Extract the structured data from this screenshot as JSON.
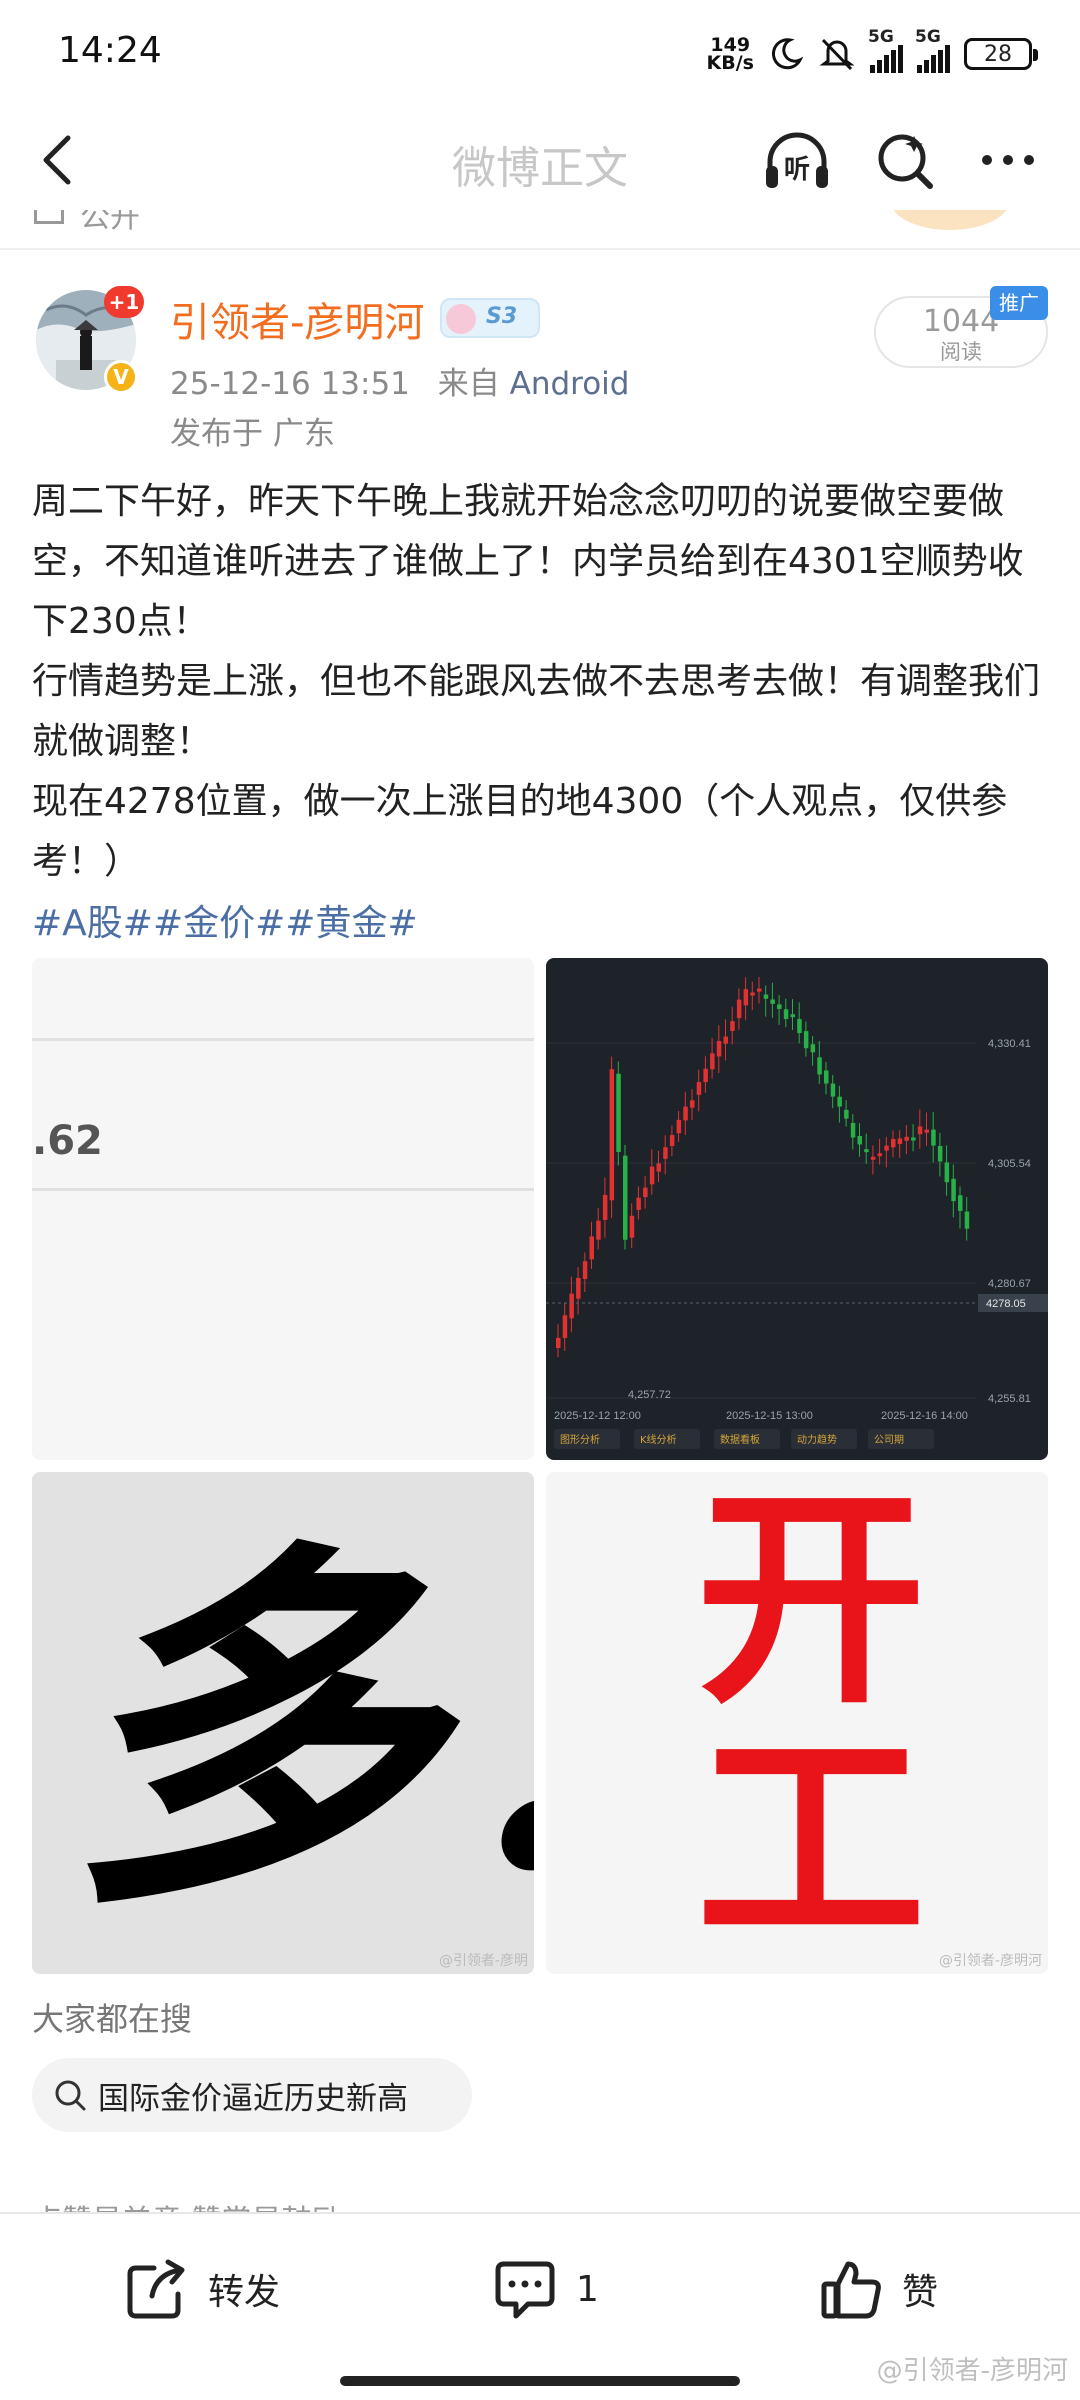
{
  "status_bar": {
    "time": "14:24",
    "net_speed_value": "149",
    "net_speed_unit": "KB/s",
    "signal_1": "5G",
    "signal_2": "5G",
    "battery": "28"
  },
  "nav": {
    "title": "微博正文",
    "listen_icon": "headphones-listen-icon",
    "listen_label": "听"
  },
  "peek": {
    "text": "公开"
  },
  "post": {
    "avatar_badge": "+1",
    "username": "引领者-彦明河",
    "level": "S3",
    "datetime": "25-12-16 13:51",
    "source_prefix": "来自",
    "source": "Android",
    "location": "发布于 广东",
    "read_count": "1044",
    "read_label": "阅读",
    "promo_tag": "推广",
    "paragraphs": [
      "周二下午好，昨天下午晚上我就开始念念叨叨的说要做空要做空，不知道谁听进去了谁做上了！内学员给到在4301空顺势收下230点！",
      "行情趋势是上涨，但也不能跟风去做不去思考去做！有调整我们就做调整！",
      "现在4278位置，做一次上涨目的地4300（个人观点，仅供参考！）"
    ],
    "hashtags": "#A股##金价##黄金#"
  },
  "images": {
    "img1_value": ".62",
    "img3_char": "多!",
    "img3_watermark": "@引领者-彦明",
    "img4_line1": "开",
    "img4_line2": "工",
    "img4_watermark": "@引领者-彦明河"
  },
  "chart_data": {
    "type": "candlestick",
    "y_ticks": [
      "4,330.41",
      "4,305.54",
      "4,280.67",
      "4,255.81"
    ],
    "current_price_label": "4278.05",
    "low_label": "4,257.72",
    "x_labels": [
      "2025-12-12 12:00",
      "2025-12-15 13:00",
      "2025-12-16 14:00"
    ],
    "buttons": [
      "图形分析",
      "K线分析",
      "数据看板",
      "动力趋势",
      "公司期"
    ],
    "colors": {
      "up": "#e23131",
      "down": "#27b247",
      "background": "#1e2229"
    }
  },
  "search": {
    "heading": "大家都在搜",
    "chip": "国际金价逼近历史新高",
    "cut_text": "点赞是美意   赞赏是鼓励"
  },
  "bottom_bar": {
    "repost": "转发",
    "comment_count": "1",
    "like": "赞",
    "watermark": "@引领者-彦明河"
  }
}
